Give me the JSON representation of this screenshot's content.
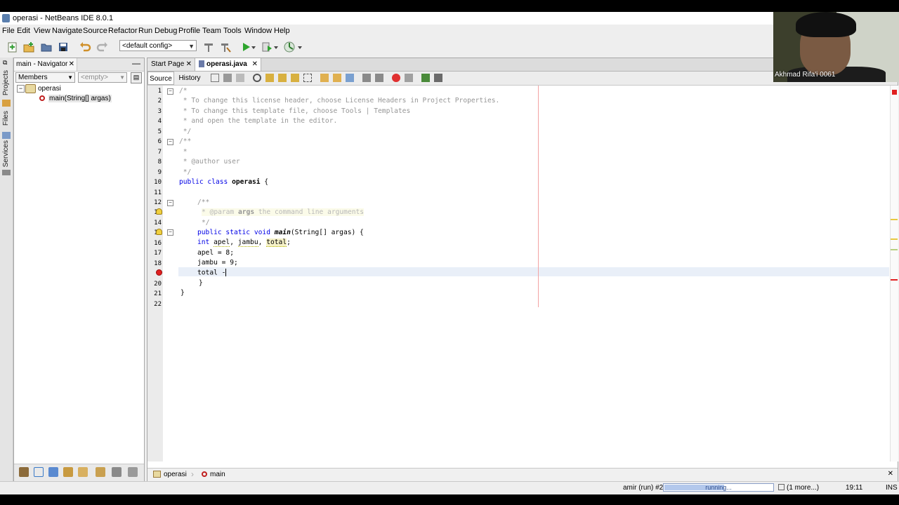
{
  "window": {
    "title": "operasi - NetBeans IDE 8.0.1"
  },
  "menu": [
    "File",
    "Edit",
    "View",
    "Navigate",
    "Source",
    "Refactor",
    "Run",
    "Debug",
    "Profile",
    "Team",
    "Tools",
    "Window",
    "Help"
  ],
  "toolbar": {
    "config_select": "<default config>"
  },
  "left_strip": {
    "tabs": [
      "Projects",
      "Files",
      "Services"
    ]
  },
  "navigator": {
    "tab_title": "main - Navigator",
    "filter_select": "Members",
    "second_select": "<empty>",
    "tree": {
      "root": "operasi",
      "child": "main(String[] argas)"
    }
  },
  "editor": {
    "tabs": [
      {
        "label": "Start Page",
        "active": false
      },
      {
        "label": "operasi.java",
        "active": true
      }
    ],
    "view_tabs": {
      "source": "Source",
      "history": "History"
    },
    "line_numbers": [
      "1",
      "2",
      "3",
      "4",
      "5",
      "6",
      "7",
      "8",
      "9",
      "10",
      "11",
      "12",
      "13",
      "14",
      "15",
      "16",
      "17",
      "18",
      "19",
      "20",
      "21",
      "22"
    ],
    "code": {
      "l1": "/*",
      "l2": " * To change this license header, choose License Headers in Project Properties.",
      "l3": " * To change this template file, choose Tools | Templates",
      "l4": " * and open the template in the editor.",
      "l5": " */",
      "l6": "/**",
      "l7": " *",
      "l8": " * @author user",
      "l9": " */",
      "l10_kw": "public class",
      "l10_name": "operasi",
      "l10_rest": " {",
      "l12": "/**",
      "l13_a": "* @param",
      "l13_b": "args",
      "l13_c": " the command line arguments",
      "l14": "*/",
      "l15_kw": "public static void",
      "l15_name": "main",
      "l15_rest": "(String[] argas) {",
      "l16_kw": "int",
      "l16_rest1": " ",
      "l16_v1": "apel",
      "l16_sep1": ", ",
      "l16_v2": "jambu",
      "l16_sep2": ", ",
      "l16_v3": "total",
      "l16_end": ";",
      "l17": "apel = 8;",
      "l18": "jambu = 9;",
      "l19": "total -",
      "l20": "}",
      "l21": "}"
    },
    "breadcrumb": {
      "class": "operasi",
      "method": "main"
    }
  },
  "statusbar": {
    "task": "amir (run) #2",
    "progress_text": "running...",
    "progress_fraction": 0.55,
    "more": "(1 more...)",
    "position": "19:11",
    "mode": "INS"
  },
  "webcam": {
    "caption": "Akhmad Rifa'i 0061"
  },
  "colors": {
    "keyword": "#0000e6",
    "comment": "#969696",
    "current_line": "#e9eff8",
    "error": "#e02020"
  }
}
